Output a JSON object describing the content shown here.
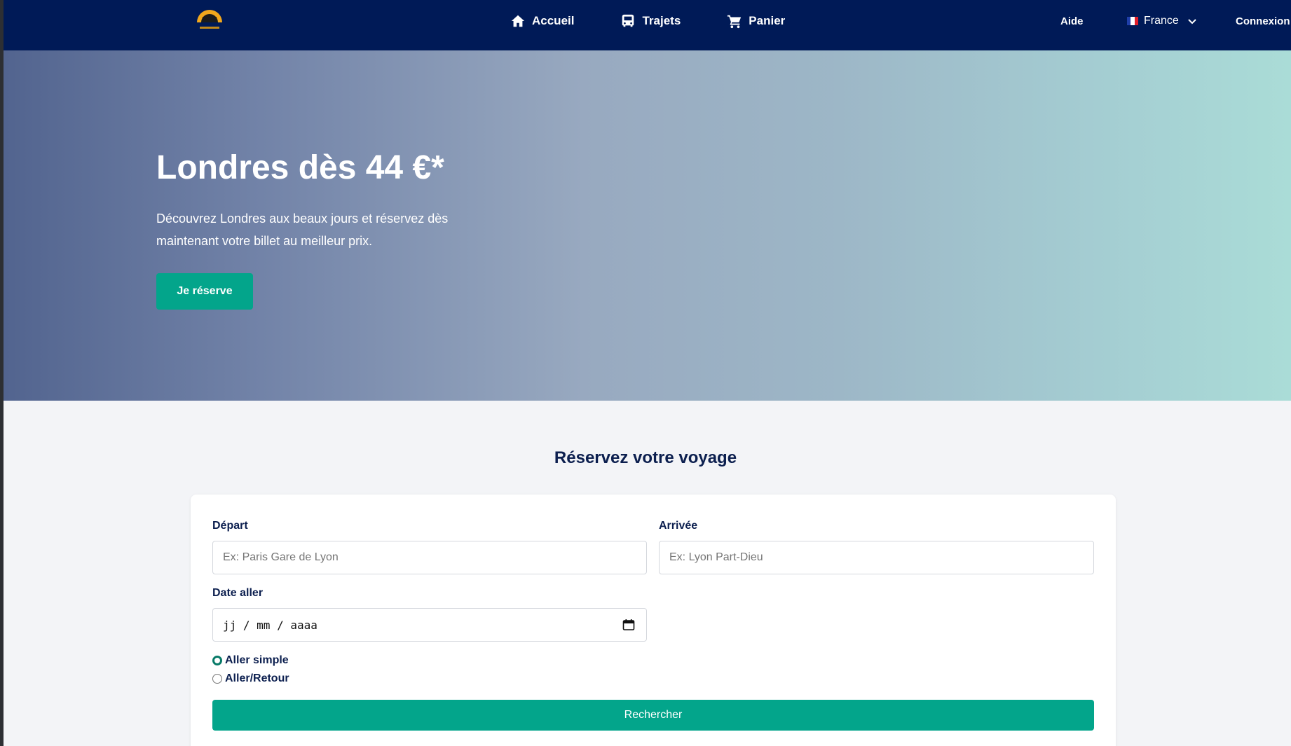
{
  "nav": {
    "links": [
      {
        "label": "Accueil",
        "icon": "home-icon"
      },
      {
        "label": "Trajets",
        "icon": "bus-icon"
      },
      {
        "label": "Panier",
        "icon": "cart-icon"
      }
    ],
    "aide": "Aide",
    "language": "France",
    "login": "Connexion"
  },
  "hero": {
    "title": "Londres dès 44 €*",
    "text": "Découvrez Londres aux beaux jours et réservez dès maintenant votre billet au meilleur prix.",
    "button": "Je réserve"
  },
  "booking": {
    "title": "Réservez votre voyage",
    "depart_label": "Départ",
    "depart_placeholder": "Ex: Paris Gare de Lyon",
    "arrivee_label": "Arrivée",
    "arrivee_placeholder": "Ex: Lyon Part-Dieu",
    "date_label": "Date aller",
    "date_placeholder": "jj / mm / aaaa",
    "trip_options": [
      {
        "label": "Aller simple",
        "selected": true
      },
      {
        "label": "Aller/Retour",
        "selected": false
      }
    ],
    "search_button": "Rechercher"
  },
  "colors": {
    "navbar": "#001a57",
    "accent": "#03a58b",
    "heading": "#0c1f4f"
  }
}
